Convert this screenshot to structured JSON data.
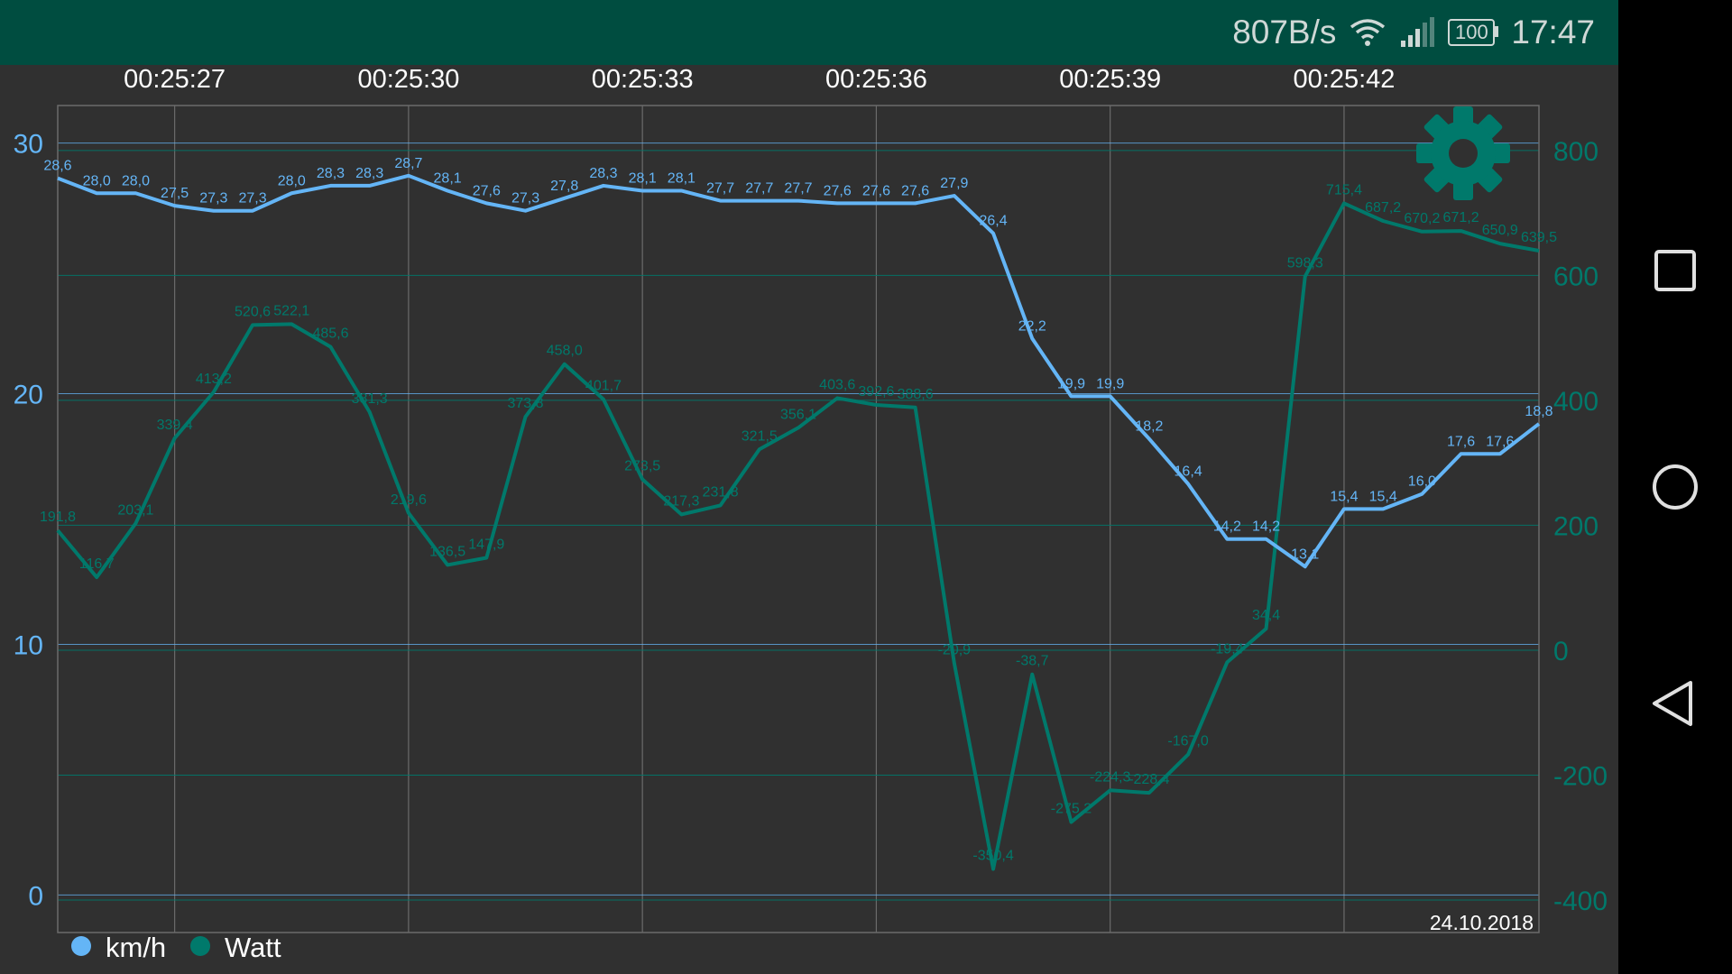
{
  "status_bar": {
    "net_speed": "807B/s",
    "battery": "100",
    "time": "17:47",
    "icons": [
      "wifi-icon",
      "signal-icon",
      "battery-icon"
    ]
  },
  "nav_bar": {
    "icons": [
      "recents-square-icon",
      "home-circle-icon",
      "back-triangle-icon"
    ]
  },
  "date_label": "24.10.2018",
  "legend": [
    {
      "name": "km/h",
      "color": "#64B5F6"
    },
    {
      "name": "Watt",
      "color": "#00796B"
    }
  ],
  "colors": {
    "background": "#303030",
    "status_bar": "#004D40",
    "speed": "#64B5F6",
    "power": "#00796B",
    "gear": "#00796B"
  },
  "chart_data": {
    "type": "line",
    "x_ticks": [
      "00:25:27",
      "00:25:30",
      "00:25:33",
      "00:25:36",
      "00:25:39",
      "00:25:42"
    ],
    "x_tick_index": [
      3,
      9,
      15,
      21,
      27,
      33
    ],
    "y_left": {
      "ticks": [
        "30",
        "20",
        "10",
        "0"
      ],
      "tick_values": [
        30,
        20,
        10,
        0
      ],
      "range": [
        -1.5,
        31.5
      ]
    },
    "y_right": {
      "ticks": [
        "800",
        "600",
        "400",
        "200",
        "0",
        "-200",
        "-400"
      ],
      "tick_values": [
        800,
        600,
        400,
        200,
        0,
        -200,
        -400
      ],
      "range": [
        -452,
        872
      ]
    },
    "grid": true,
    "legend_position": "bottom-left",
    "series": [
      {
        "name": "km/h",
        "axis": "left",
        "values": [
          28.6,
          28.0,
          28.0,
          27.5,
          27.3,
          27.3,
          28.0,
          28.3,
          28.3,
          28.7,
          28.1,
          27.6,
          27.3,
          27.8,
          28.3,
          28.1,
          28.1,
          27.7,
          27.7,
          27.7,
          27.6,
          27.6,
          27.6,
          27.9,
          26.4,
          22.2,
          19.9,
          19.9,
          18.2,
          16.4,
          14.2,
          14.2,
          13.1,
          15.4,
          15.4,
          16.0,
          17.6,
          17.6,
          18.8
        ],
        "labels": [
          "28,6",
          "28,0",
          "28,0",
          "27,5",
          "27,3",
          "27,3",
          "28,0",
          "28,3",
          "28,3",
          "28,7",
          "28,1",
          "27,6",
          "27,3",
          "27,8",
          "28,3",
          "28,1",
          "28,1",
          "27,7",
          "27,7",
          "27,7",
          "27,6",
          "27,6",
          "27,6",
          "27,9",
          "26,4",
          "22,2",
          "19,9",
          "19,9",
          "18,2",
          "16,4",
          "14,2",
          "14,2",
          "13,1",
          "15,4",
          "15,4",
          "16,0",
          "17,6",
          "17,6",
          "18,8"
        ]
      },
      {
        "name": "Watt",
        "axis": "right",
        "values": [
          191.8,
          116.7,
          203.1,
          339.4,
          413.2,
          520.6,
          522.1,
          485.6,
          381.3,
          219.6,
          136.5,
          147.9,
          373.8,
          458.0,
          401.7,
          273.5,
          217.3,
          231.8,
          321.5,
          356.1,
          403.6,
          392.6,
          388.6,
          -20.9,
          -350.4,
          -38.7,
          -275.2,
          -224.3,
          -228.4,
          -167.0,
          -19.4,
          34.4,
          598.3,
          715.4,
          687.2,
          670.2,
          671.2,
          650.9,
          639.5
        ],
        "labels": [
          "191,8",
          "116,7",
          "203,1",
          "339,4",
          "413,2",
          "520,6",
          "522,1",
          "485,6",
          "381,3",
          "219,6",
          "136,5",
          "147,9",
          "373,8",
          "458,0",
          "401,7",
          "273,5",
          "217,3",
          "231,8",
          "321,5",
          "356,1",
          "403,6",
          "392,6",
          "388,6",
          "-20,9",
          "-350,4",
          "-38,7",
          "-275,2",
          "-224,3",
          "-228,4",
          "-167,0",
          "-19,4",
          "34,4",
          "598,3",
          "715,4",
          "687,2",
          "670,2",
          "671,2",
          "650,9",
          "639,5"
        ]
      }
    ]
  }
}
